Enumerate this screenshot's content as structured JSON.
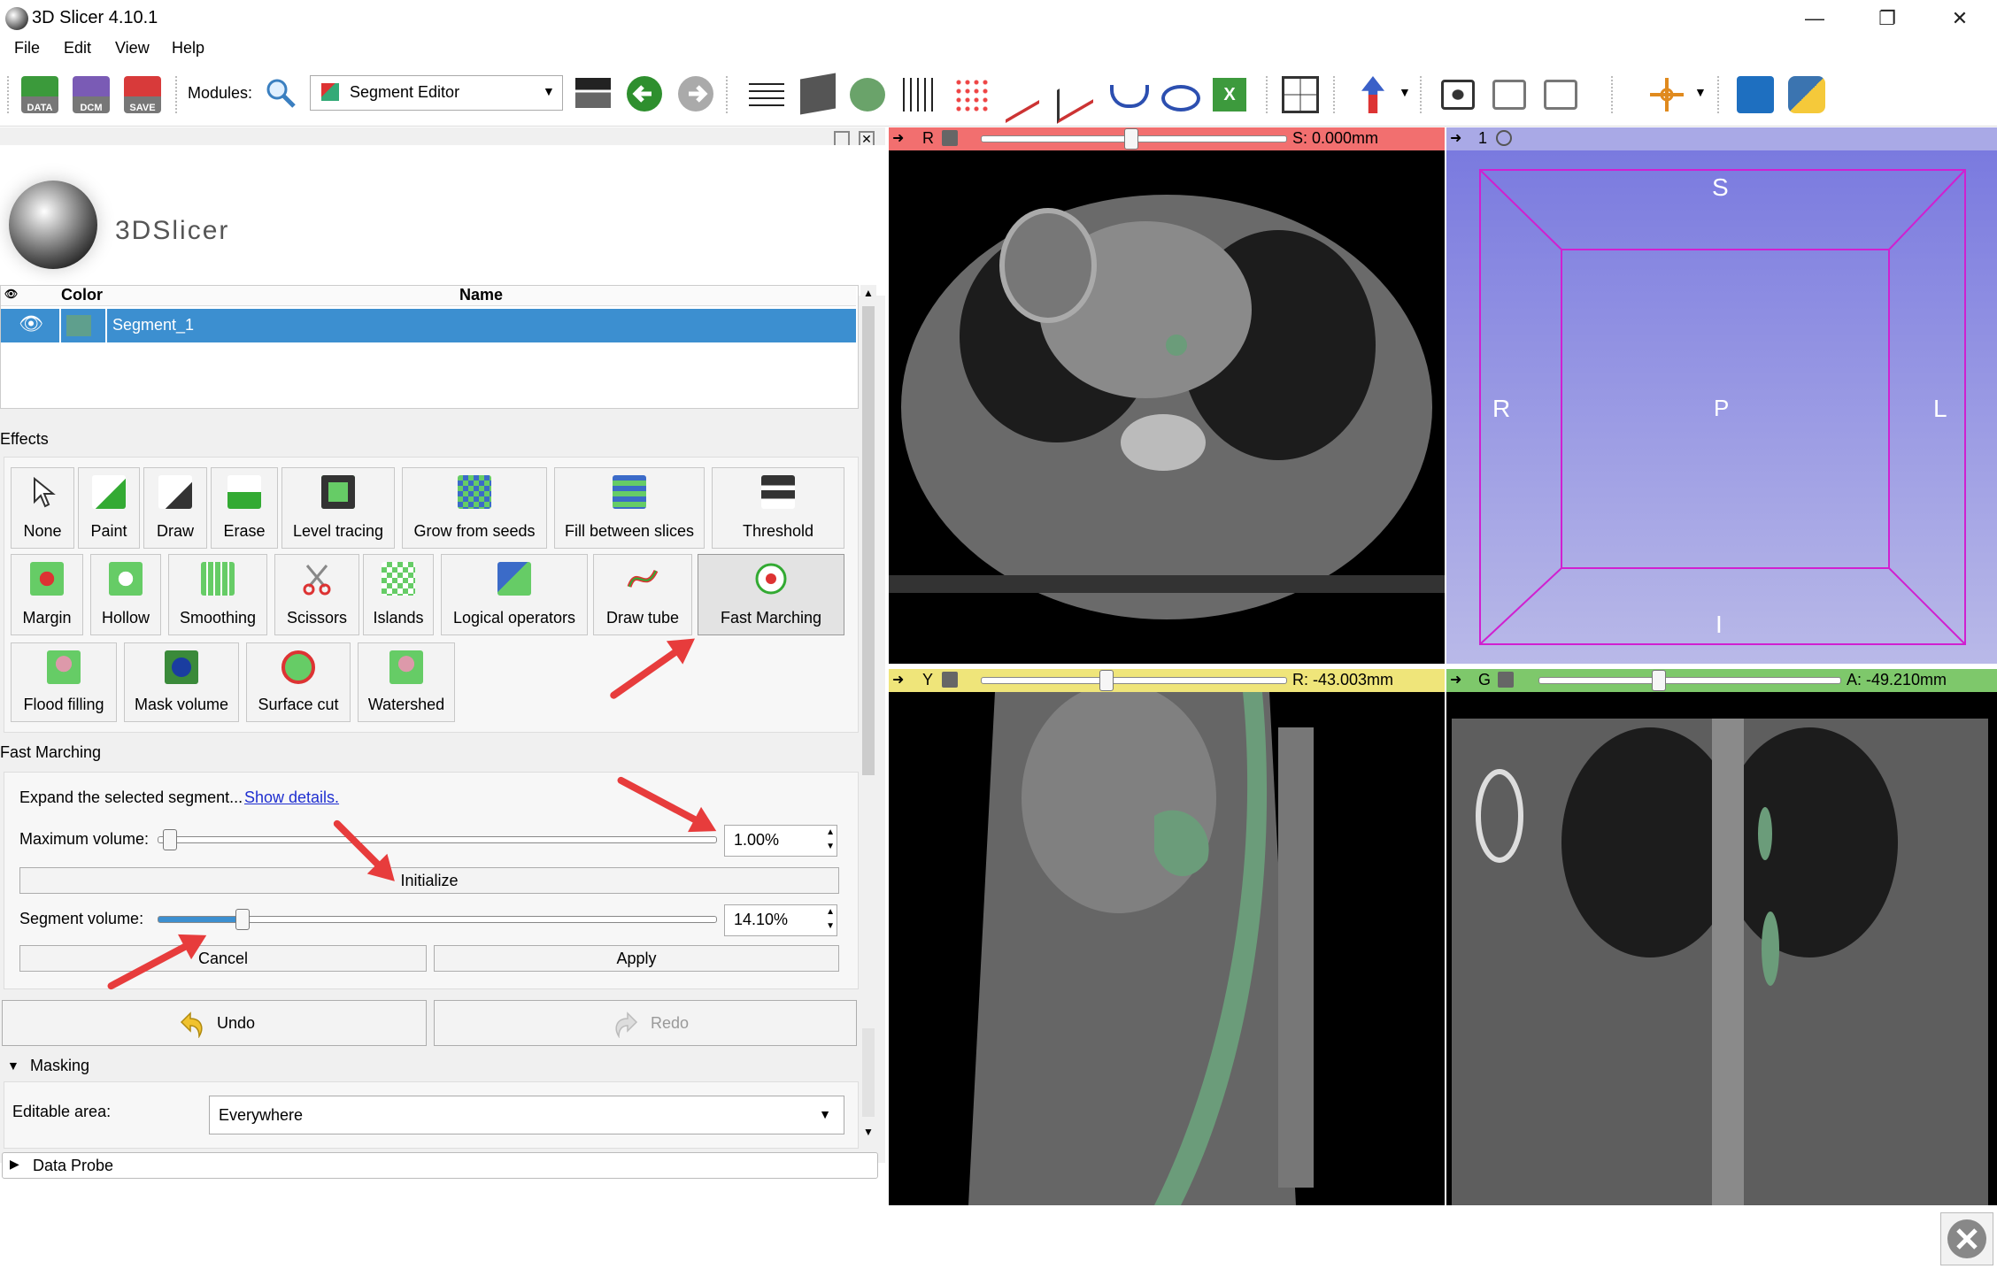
{
  "window": {
    "title": "3D Slicer 4.10.1",
    "minimize": "—",
    "restore": "❐",
    "close": "✕"
  },
  "menu": [
    "File",
    "Edit",
    "View",
    "Help"
  ],
  "toolbar": {
    "data_label": "DATA",
    "dcm_label": "DCM",
    "save_label": "SAVE",
    "modules_label": "Modules:",
    "module_selected": "Segment Editor"
  },
  "logo": {
    "text": "3DSlicer"
  },
  "segments_table": {
    "headers": {
      "color": "Color",
      "name": "Name"
    },
    "rows": [
      {
        "name": "Segment_1",
        "color": "#5f9f8d"
      }
    ]
  },
  "effects": {
    "title": "Effects",
    "buttons": [
      "None",
      "Paint",
      "Draw",
      "Erase",
      "Level tracing",
      "Grow from seeds",
      "Fill between slices",
      "Threshold",
      "Margin",
      "Hollow",
      "Smoothing",
      "Scissors",
      "Islands",
      "Logical operators",
      "Draw tube",
      "Fast Marching",
      "Flood filling",
      "Mask volume",
      "Surface cut",
      "Watershed"
    ]
  },
  "fast_marching": {
    "title": "Fast Marching",
    "description": "Expand the selected segment...",
    "details_link": "Show details.",
    "max_volume_label": "Maximum volume:",
    "max_volume_value": "1.00%",
    "max_volume_fraction": 0.0,
    "initialize": "Initialize",
    "segment_volume_label": "Segment volume:",
    "segment_volume_value": "14.10%",
    "segment_volume_fraction": 0.15,
    "cancel": "Cancel",
    "apply": "Apply"
  },
  "undo": "Undo",
  "redo": "Redo",
  "masking": {
    "title": "Masking",
    "editable_area_label": "Editable area:",
    "editable_area_value": "Everywhere"
  },
  "data_probe": "Data Probe",
  "views": {
    "red": {
      "letter": "R",
      "offset": "S: 0.000mm",
      "bar_color": "#f26f6f"
    },
    "threed": {
      "letter": "1",
      "bar_color": "#a9a9e6",
      "labels": {
        "top": "S",
        "left": "R",
        "center": "P",
        "right": "L",
        "bottom": "I"
      }
    },
    "yellow": {
      "letter": "Y",
      "offset": "R: -43.003mm",
      "bar_color": "#efe57a"
    },
    "green": {
      "letter": "G",
      "offset": "A: -49.210mm",
      "bar_color": "#7ec86b"
    }
  },
  "colors": {
    "selection": "#3c8fd0",
    "accent_red": "#e73c3c",
    "segment": "#5f9f8d"
  }
}
